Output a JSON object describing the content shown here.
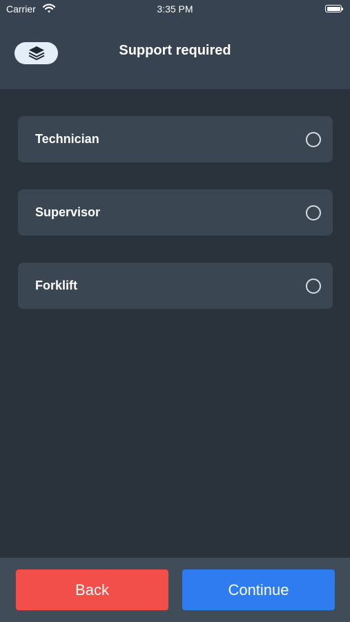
{
  "status_bar": {
    "carrier": "Carrier",
    "time": "3:35 PM",
    "wifi_icon": "wifi-icon",
    "battery_icon": "battery-icon"
  },
  "header": {
    "menu_icon": "layers-icon",
    "title": "Support required"
  },
  "options": [
    {
      "label": "Technician",
      "selected": false
    },
    {
      "label": "Supervisor",
      "selected": false
    },
    {
      "label": "Forklift",
      "selected": false
    }
  ],
  "footer": {
    "back_label": "Back",
    "continue_label": "Continue"
  },
  "colors": {
    "background": "#2a323c",
    "header": "#374350",
    "option_card": "#3a4651",
    "footer": "#404c58",
    "back_button": "#f24e4a",
    "continue_button": "#2f7cf0",
    "menu_pill": "#e3eef8"
  }
}
